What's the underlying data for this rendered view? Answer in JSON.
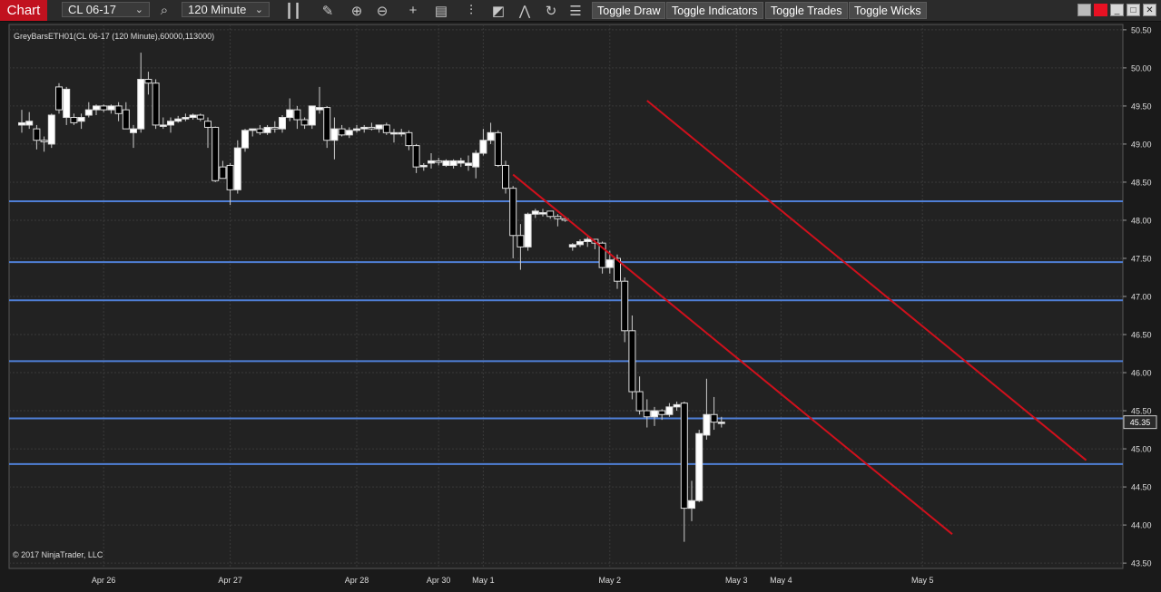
{
  "toolbar": {
    "tab_label": "Chart",
    "instrument": "CL 06-17",
    "period": "120 Minute",
    "buttons": [
      "Toggle Draw",
      "Toggle Indicators",
      "Toggle Trades",
      "Toggle Wicks"
    ],
    "icons": [
      "bar-style-icon",
      "pencil-icon",
      "zoom-in-icon",
      "zoom-out-icon",
      "crosshair-icon",
      "data-box-icon",
      "strategy-icon",
      "chart-style-icon",
      "indicators-icon",
      "refresh-icon",
      "properties-icon"
    ]
  },
  "panel_title": "GreyBarsETH01(CL 06-17 (120 Minute),60000,113000)",
  "copyright": "© 2017 NinjaTrader, LLC",
  "price_badge": "45.35",
  "colors": {
    "background": "#1a1a1a",
    "plot_bg": "#222222",
    "grid": "#3a3a3a",
    "up_candle": "#ffffff",
    "down_candle": "#000000",
    "wick": "#cccccc",
    "support_lines": "#4f7fd6",
    "channel_lines": "#d0101c",
    "badge_bg": "#2a2a2a"
  },
  "chart_data": {
    "type": "candlestick",
    "yticks": [
      "50.50",
      "50.00",
      "49.50",
      "49.00",
      "48.50",
      "48.00",
      "47.50",
      "47.00",
      "46.50",
      "46.00",
      "45.50",
      "45.00",
      "44.50",
      "44.00",
      "43.50"
    ],
    "ylim": [
      43.43,
      50.57
    ],
    "x_labels": [
      {
        "label": "Apr 26",
        "bar": 11
      },
      {
        "label": "Apr 27",
        "bar": 28
      },
      {
        "label": "Apr 28",
        "bar": 45
      },
      {
        "label": "Apr 30",
        "bar": 56
      },
      {
        "label": "May 1",
        "bar": 62
      },
      {
        "label": "May 2",
        "bar": 79
      },
      {
        "label": "May 3",
        "bar": 96
      },
      {
        "label": "May 4",
        "bar": 102
      },
      {
        "label": "May 5",
        "bar": 121
      }
    ],
    "horizontal_lines": [
      48.25,
      47.45,
      46.95,
      46.15,
      45.4,
      44.8
    ],
    "channel_lines": [
      {
        "from": {
          "bar": 66,
          "price": 48.6
        },
        "to": {
          "bar": 125,
          "price": 43.88
        }
      },
      {
        "from": {
          "bar": 84,
          "price": 49.57
        },
        "to": {
          "bar": 143,
          "price": 44.85
        }
      }
    ],
    "candles": [
      {
        "o": 49.25,
        "h": 49.45,
        "l": 49.15,
        "c": 49.28
      },
      {
        "o": 49.25,
        "h": 49.42,
        "l": 49.2,
        "c": 49.3
      },
      {
        "o": 49.2,
        "h": 49.25,
        "l": 48.93,
        "c": 49.05
      },
      {
        "o": 49.05,
        "h": 49.1,
        "l": 48.9,
        "c": 49.03
      },
      {
        "o": 49.0,
        "h": 49.4,
        "l": 48.95,
        "c": 49.38
      },
      {
        "o": 49.75,
        "h": 49.8,
        "l": 49.4,
        "c": 49.45
      },
      {
        "o": 49.35,
        "h": 49.75,
        "l": 49.25,
        "c": 49.72
      },
      {
        "o": 49.35,
        "h": 49.4,
        "l": 49.25,
        "c": 49.28
      },
      {
        "o": 49.3,
        "h": 49.4,
        "l": 49.2,
        "c": 49.35
      },
      {
        "o": 49.38,
        "h": 49.55,
        "l": 49.35,
        "c": 49.45
      },
      {
        "o": 49.45,
        "h": 49.52,
        "l": 49.38,
        "c": 49.5
      },
      {
        "o": 49.5,
        "h": 49.52,
        "l": 49.42,
        "c": 49.45
      },
      {
        "o": 49.45,
        "h": 49.52,
        "l": 49.4,
        "c": 49.5
      },
      {
        "o": 49.5,
        "h": 49.55,
        "l": 49.3,
        "c": 49.4
      },
      {
        "o": 49.45,
        "h": 49.55,
        "l": 49.2,
        "c": 49.2
      },
      {
        "o": 49.15,
        "h": 49.25,
        "l": 48.95,
        "c": 49.2
      },
      {
        "o": 49.2,
        "h": 50.2,
        "l": 49.15,
        "c": 49.85
      },
      {
        "o": 49.85,
        "h": 49.95,
        "l": 49.65,
        "c": 49.8
      },
      {
        "o": 49.8,
        "h": 49.85,
        "l": 49.2,
        "c": 49.25
      },
      {
        "o": 49.25,
        "h": 49.35,
        "l": 49.2,
        "c": 49.25
      },
      {
        "o": 49.25,
        "h": 49.35,
        "l": 49.15,
        "c": 49.3
      },
      {
        "o": 49.3,
        "h": 49.37,
        "l": 49.28,
        "c": 49.33
      },
      {
        "o": 49.33,
        "h": 49.4,
        "l": 49.3,
        "c": 49.35
      },
      {
        "o": 49.35,
        "h": 49.4,
        "l": 49.32,
        "c": 49.38
      },
      {
        "o": 49.38,
        "h": 49.4,
        "l": 49.3,
        "c": 49.33
      },
      {
        "o": 49.3,
        "h": 49.35,
        "l": 48.95,
        "c": 49.22
      },
      {
        "o": 49.22,
        "h": 49.23,
        "l": 48.5,
        "c": 48.52
      },
      {
        "o": 48.7,
        "h": 48.78,
        "l": 48.55,
        "c": 48.55
      },
      {
        "o": 48.72,
        "h": 48.75,
        "l": 48.2,
        "c": 48.4
      },
      {
        "o": 48.4,
        "h": 49.05,
        "l": 48.35,
        "c": 48.95
      },
      {
        "o": 48.95,
        "h": 49.2,
        "l": 48.9,
        "c": 49.18
      },
      {
        "o": 49.18,
        "h": 49.2,
        "l": 49.1,
        "c": 49.2
      },
      {
        "o": 49.2,
        "h": 49.25,
        "l": 49.12,
        "c": 49.15
      },
      {
        "o": 49.15,
        "h": 49.25,
        "l": 49.12,
        "c": 49.22
      },
      {
        "o": 49.22,
        "h": 49.3,
        "l": 49.15,
        "c": 49.2
      },
      {
        "o": 49.2,
        "h": 49.38,
        "l": 49.15,
        "c": 49.35
      },
      {
        "o": 49.35,
        "h": 49.6,
        "l": 49.3,
        "c": 49.45
      },
      {
        "o": 49.45,
        "h": 49.5,
        "l": 49.2,
        "c": 49.32
      },
      {
        "o": 49.32,
        "h": 49.35,
        "l": 49.2,
        "c": 49.25
      },
      {
        "o": 49.25,
        "h": 49.5,
        "l": 49.2,
        "c": 49.5
      },
      {
        "o": 49.45,
        "h": 49.75,
        "l": 49.4,
        "c": 49.48
      },
      {
        "o": 49.48,
        "h": 49.5,
        "l": 48.95,
        "c": 49.05
      },
      {
        "o": 49.05,
        "h": 49.35,
        "l": 48.8,
        "c": 49.2
      },
      {
        "o": 49.2,
        "h": 49.25,
        "l": 49.1,
        "c": 49.12
      },
      {
        "o": 49.12,
        "h": 49.22,
        "l": 49.08,
        "c": 49.18
      },
      {
        "o": 49.18,
        "h": 49.25,
        "l": 49.15,
        "c": 49.2
      },
      {
        "o": 49.2,
        "h": 49.25,
        "l": 49.15,
        "c": 49.22
      },
      {
        "o": 49.22,
        "h": 49.28,
        "l": 49.18,
        "c": 49.2
      },
      {
        "o": 49.2,
        "h": 49.25,
        "l": 49.15,
        "c": 49.25
      },
      {
        "o": 49.25,
        "h": 49.28,
        "l": 49.12,
        "c": 49.15
      },
      {
        "o": 49.15,
        "h": 49.2,
        "l": 49.02,
        "c": 49.15
      },
      {
        "o": 49.15,
        "h": 49.2,
        "l": 49.1,
        "c": 49.15
      },
      {
        "o": 49.15,
        "h": 49.18,
        "l": 48.92,
        "c": 48.98
      },
      {
        "o": 48.98,
        "h": 49.0,
        "l": 48.62,
        "c": 48.7
      },
      {
        "o": 48.72,
        "h": 48.75,
        "l": 48.65,
        "c": 48.72
      },
      {
        "o": 48.75,
        "h": 48.88,
        "l": 48.68,
        "c": 48.78
      },
      {
        "o": 48.78,
        "h": 48.82,
        "l": 48.72,
        "c": 48.76
      },
      {
        "o": 48.72,
        "h": 48.8,
        "l": 48.7,
        "c": 48.78
      },
      {
        "o": 48.72,
        "h": 48.8,
        "l": 48.68,
        "c": 48.78
      },
      {
        "o": 48.75,
        "h": 48.82,
        "l": 48.7,
        "c": 48.78
      },
      {
        "o": 48.72,
        "h": 48.85,
        "l": 48.65,
        "c": 48.75
      },
      {
        "o": 48.7,
        "h": 48.92,
        "l": 48.55,
        "c": 48.88
      },
      {
        "o": 48.88,
        "h": 49.2,
        "l": 48.85,
        "c": 49.05
      },
      {
        "o": 49.05,
        "h": 49.28,
        "l": 49.0,
        "c": 49.15
      },
      {
        "o": 49.15,
        "h": 49.18,
        "l": 48.7,
        "c": 48.72
      },
      {
        "o": 48.72,
        "h": 48.78,
        "l": 48.35,
        "c": 48.42
      },
      {
        "o": 48.42,
        "h": 48.45,
        "l": 47.5,
        "c": 47.8
      },
      {
        "o": 47.8,
        "h": 47.95,
        "l": 47.35,
        "c": 47.65
      },
      {
        "o": 47.65,
        "h": 48.1,
        "l": 47.6,
        "c": 48.08
      },
      {
        "o": 48.08,
        "h": 48.15,
        "l": 48.03,
        "c": 48.12
      },
      {
        "o": 48.1,
        "h": 48.15,
        "l": 48.05,
        "c": 48.1
      },
      {
        "o": 48.12,
        "h": 48.12,
        "l": 48.02,
        "c": 48.05
      },
      {
        "o": 48.05,
        "h": 48.08,
        "l": 47.92,
        "c": 48.02
      },
      {
        "o": 48.02,
        "h": 48.05,
        "l": 47.98,
        "c": 48.0
      },
      {
        "o": 47.65,
        "h": 47.7,
        "l": 47.6,
        "c": 47.68
      },
      {
        "o": 47.68,
        "h": 47.75,
        "l": 47.65,
        "c": 47.72
      },
      {
        "o": 47.72,
        "h": 47.78,
        "l": 47.65,
        "c": 47.75
      },
      {
        "o": 47.75,
        "h": 47.75,
        "l": 47.62,
        "c": 47.7
      },
      {
        "o": 47.7,
        "h": 47.72,
        "l": 47.3,
        "c": 47.38
      },
      {
        "o": 47.38,
        "h": 47.6,
        "l": 47.3,
        "c": 47.48
      },
      {
        "o": 47.5,
        "h": 47.55,
        "l": 47.1,
        "c": 47.2
      },
      {
        "o": 47.2,
        "h": 47.25,
        "l": 46.4,
        "c": 46.55
      },
      {
        "o": 46.55,
        "h": 46.75,
        "l": 45.65,
        "c": 45.75
      },
      {
        "o": 45.75,
        "h": 45.95,
        "l": 45.45,
        "c": 45.5
      },
      {
        "o": 45.5,
        "h": 45.65,
        "l": 45.28,
        "c": 45.42
      },
      {
        "o": 45.42,
        "h": 45.55,
        "l": 45.3,
        "c": 45.5
      },
      {
        "o": 45.5,
        "h": 45.52,
        "l": 45.38,
        "c": 45.45
      },
      {
        "o": 45.45,
        "h": 45.6,
        "l": 45.42,
        "c": 45.55
      },
      {
        "o": 45.55,
        "h": 45.62,
        "l": 45.5,
        "c": 45.58
      },
      {
        "o": 45.6,
        "h": 45.62,
        "l": 43.78,
        "c": 44.22
      },
      {
        "o": 44.22,
        "h": 44.58,
        "l": 44.05,
        "c": 44.32
      },
      {
        "o": 44.32,
        "h": 45.25,
        "l": 44.3,
        "c": 45.2
      },
      {
        "o": 45.18,
        "h": 45.92,
        "l": 45.12,
        "c": 45.45
      },
      {
        "o": 45.45,
        "h": 45.68,
        "l": 45.25,
        "c": 45.35
      },
      {
        "o": 45.35,
        "h": 45.42,
        "l": 45.28,
        "c": 45.35
      }
    ]
  }
}
